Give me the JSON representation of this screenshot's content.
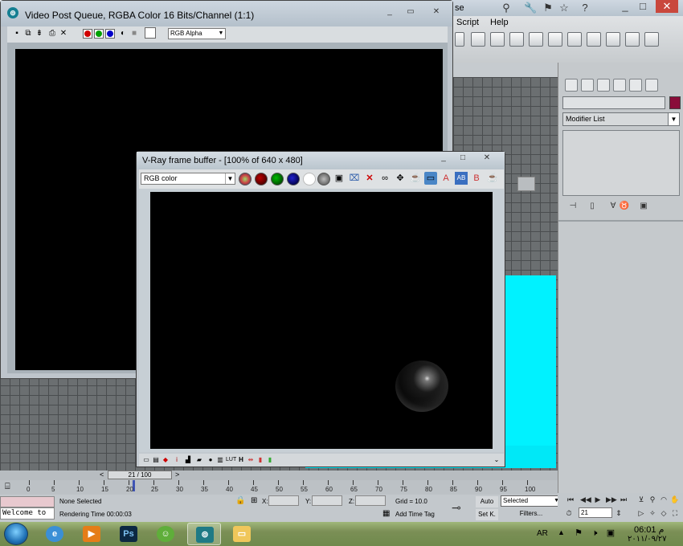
{
  "max_app": {
    "title_fragment": "se",
    "menu_script": "Script",
    "menu_help": "Help",
    "modifier_list_label": "Modifier List"
  },
  "video_post_queue": {
    "title": "Video Post Queue, RGBA Color 16 Bits/Channel (1:1)",
    "channel_select": "RGB Alpha"
  },
  "vray_frame_buffer": {
    "title": "V-Ray frame buffer - [100% of 640 x 480]",
    "channel_select": "RGB color"
  },
  "timeline": {
    "slider_label": "21 / 100",
    "prev": "<",
    "next": ">",
    "current_frame": 21,
    "ticks": [
      "0",
      "5",
      "10",
      "15",
      "20",
      "25",
      "30",
      "35",
      "40",
      "45",
      "50",
      "55",
      "60",
      "65",
      "70",
      "75",
      "80",
      "85",
      "90",
      "95",
      "100"
    ]
  },
  "status_bar": {
    "maxscript_text": "Welcome to",
    "selection_status": "None Selected",
    "rendering_time": "Rendering Time  00:00:03",
    "x_label": "X:",
    "y_label": "Y:",
    "z_label": "Z:",
    "grid": "Grid = 10.0",
    "add_time_tag": "Add Time Tag",
    "auto_key": "Auto",
    "set_key": "Set K.",
    "key_filter_value": "Selected",
    "filters": "Filters...",
    "frame_value": "21"
  },
  "taskbar": {
    "photoshop_label": "Ps",
    "language": "AR",
    "time": "06:01 م",
    "date": "٢٠١١/٠٩/٢٧"
  },
  "colors": {
    "viewport_plane": "#00f2ff",
    "object_color": "#8a0d3a",
    "red_channel": "#d00000",
    "green_channel": "#00a000",
    "blue_channel": "#0000c8"
  }
}
